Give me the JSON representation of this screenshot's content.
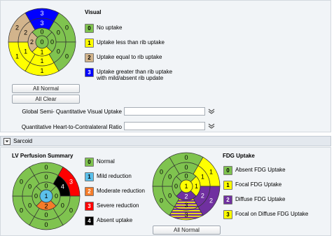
{
  "visual": {
    "title": "Visual",
    "legend": [
      {
        "code": "0",
        "color": "#7fc34f",
        "text": "No uptake"
      },
      {
        "code": "1",
        "color": "#ffff00",
        "text": "Uptake less than rib uptake"
      },
      {
        "code": "2",
        "color": "#d2b48c",
        "text": "Uptake equal to rib uptake"
      },
      {
        "code": "3",
        "color": "#0000ff",
        "text": "Uptake greater than rib uptake",
        "text2": "with mild/absent rib update"
      }
    ],
    "bullseye": {
      "outer": [
        "3",
        "0",
        "0",
        "1",
        "1",
        "2"
      ],
      "mid": [
        "3",
        "0",
        "0",
        "1",
        "1",
        "2"
      ],
      "inner": [
        "0",
        "0",
        "1",
        "2"
      ],
      "apex": "0",
      "outer_colors": [
        "#0000ff",
        "#7fc34f",
        "#7fc34f",
        "#ffff00",
        "#ffff00",
        "#d2b48c"
      ],
      "mid_colors": [
        "#0000ff",
        "#7fc34f",
        "#7fc34f",
        "#ffff00",
        "#ffff00",
        "#d2b48c"
      ],
      "inner_colors": [
        "#7fc34f",
        "#7fc34f",
        "#ffff00",
        "#d2b48c"
      ],
      "apex_color": "#7fc34f"
    },
    "all_normal": "All Normal",
    "all_clear": "All Clear",
    "global_label": "Global  Semi- Quantitative Visual Uptake",
    "global_value": "",
    "hcl_label": "Quantitative  Heart-to-Contralateral Ratio",
    "hcl_value": ""
  },
  "sarcoid": {
    "header": "Sarcoid",
    "lv_title": "LV Perfusion Summary",
    "lv_legend": [
      {
        "code": "0",
        "color": "#7fc34f",
        "text": "Normal"
      },
      {
        "code": "1",
        "color": "#5bc0eb",
        "text": "Mild reduction"
      },
      {
        "code": "2",
        "color": "#f47c2a",
        "text": "Moderate reduction"
      },
      {
        "code": "3",
        "color": "#ff0000",
        "text": "Severe reduction"
      },
      {
        "code": "4",
        "color": "#000000",
        "text": "Absent uptake"
      }
    ],
    "lv_bullseye": {
      "outer": [
        "0",
        "3",
        "0",
        "0",
        "0",
        "0"
      ],
      "mid": [
        "0",
        "4",
        "0",
        "0",
        "0",
        "0"
      ],
      "inner": [
        "0",
        "0",
        "2",
        "0"
      ],
      "apex": "1",
      "outer_colors": [
        "#7fc34f",
        "#ff0000",
        "#7fc34f",
        "#7fc34f",
        "#7fc34f",
        "#7fc34f"
      ],
      "mid_colors": [
        "#7fc34f",
        "#000000",
        "#7fc34f",
        "#7fc34f",
        "#7fc34f",
        "#7fc34f"
      ],
      "inner_colors": [
        "#7fc34f",
        "#7fc34f",
        "#f47c2a",
        "#7fc34f"
      ],
      "apex_color": "#5bc0eb"
    },
    "fdg_title": "FDG Uptake",
    "fdg_legend": [
      {
        "code": "0",
        "color": "#7fc34f",
        "text": "Absent FDG Uptake"
      },
      {
        "code": "1",
        "color": "#ffff00",
        "text": "Focal FDG Uptake"
      },
      {
        "code": "2",
        "color": "#7030a0",
        "text": "Diffuse FDG Uptake"
      },
      {
        "code": "3",
        "color": "#ffff00",
        "text": "Focal on Diffuse FDG Uptake"
      }
    ],
    "fdg_bullseye": {
      "outer": [
        "0",
        "1",
        "2",
        "3",
        "0",
        "0"
      ],
      "mid": [
        "0",
        "1",
        "2",
        "3",
        "0",
        "0"
      ],
      "inner": [
        "0",
        "1",
        "2",
        "0"
      ],
      "apex": "1",
      "outer_colors": [
        "#7fc34f",
        "#ffff00",
        "#7030a0",
        "#ffff00",
        "#7fc34f",
        "#7fc34f"
      ],
      "mid_colors": [
        "#7fc34f",
        "#ffff00",
        "#7030a0",
        "#ffff00",
        "#7fc34f",
        "#7fc34f"
      ],
      "inner_colors": [
        "#7fc34f",
        "#ffff00",
        "#7030a0",
        "#7fc34f"
      ],
      "apex_color": "#ffff00"
    },
    "all_normal": "All Normal"
  }
}
